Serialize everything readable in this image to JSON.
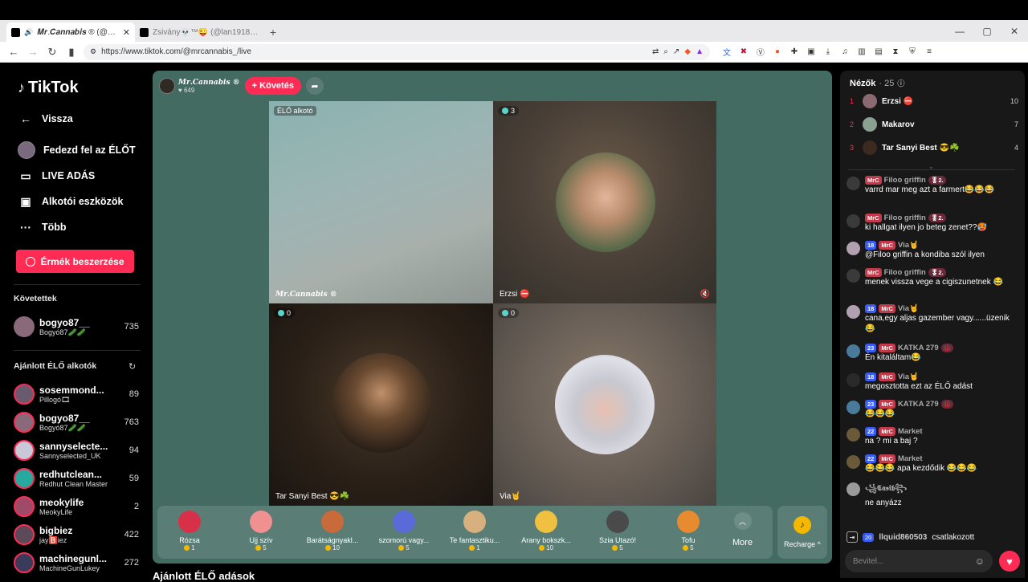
{
  "browser": {
    "tabs": [
      {
        "title": "𝑴𝒓.𝑪𝒂𝒏𝒏𝒂𝒃𝒊𝒔 ® (@mrcan",
        "close": "✕"
      },
      {
        "title": "Zsivány💀™😜 (@lan1918) ÉLŐ adás"
      }
    ],
    "new_tab": "+",
    "window": [
      "—",
      "▢",
      "✕"
    ],
    "url": "https://www.tiktok.com/@mrcannabis_/live"
  },
  "sidebar": {
    "logo": "TikTok",
    "nav": [
      {
        "label": "Vissza",
        "icon": "←"
      },
      {
        "label": "Fedezd fel az ÉLŐT",
        "icon": ""
      },
      {
        "label": "LIVE ADÁS",
        "icon": "▭"
      },
      {
        "label": "Alkotói eszközök",
        "icon": "▣"
      },
      {
        "label": "Több",
        "icon": "···"
      }
    ],
    "coins_button": "Érmék beszerzése",
    "following_title": "Követettek",
    "following": [
      {
        "name": "bogyo87__",
        "sub": "Bogyó87🥒🥒",
        "count": "735",
        "color": "#8a6a7a"
      }
    ],
    "recommended_title": "Ajánlott ÉLŐ alkotók",
    "recommended": [
      {
        "name": "sosemmond...",
        "sub": "Pillogó🎞",
        "count": "89",
        "color": "#6a5a70"
      },
      {
        "name": "bogyo87__",
        "sub": "Bogyó87🥒🥒",
        "count": "763",
        "color": "#8a6a7a"
      },
      {
        "name": "sannyselecte...",
        "sub": "Sannyselected_UK",
        "count": "94",
        "color": "#c8c8d8"
      },
      {
        "name": "redhutclean...",
        "sub": "Redhut Clean Master",
        "count": "59",
        "color": "#27a9a0"
      },
      {
        "name": "meokylife",
        "sub": "MeokyLife",
        "count": "2",
        "color": "#a04a6a"
      },
      {
        "name": "bigbiez",
        "sub": "jay🅱️iez",
        "count": "422",
        "color": "#5a4a5a"
      },
      {
        "name": "machinegunl...",
        "sub": "MachineGunLukey",
        "count": "272",
        "color": "#3a3a5a"
      }
    ]
  },
  "stage": {
    "host": {
      "name": "𝑴𝒓.𝑪𝒂𝒏𝒏𝒂𝒃𝒊𝒔 ®",
      "likes": "649"
    },
    "follow_label": "+ Követés",
    "cells": [
      {
        "tag": "ÉLŐ alkotó",
        "label": "𝑴𝒓.𝑪𝒂𝒏𝒏𝒂𝒃𝒊𝒔 ®"
      },
      {
        "badge": "3",
        "label": "Erzsi ⛔"
      },
      {
        "badge": "0",
        "label": "Tar Sanyi Best 😎☘️"
      },
      {
        "badge": "0",
        "label": "Via🤘"
      }
    ],
    "gifts": [
      {
        "name": "Rózsa",
        "price": "1",
        "color": "#d9304a"
      },
      {
        "name": "Ujj szív",
        "price": "5",
        "color": "#f09090"
      },
      {
        "name": "Barátságnyakl...",
        "price": "10",
        "color": "#c86a3a"
      },
      {
        "name": "szomorú vagy...",
        "price": "5",
        "color": "#5a6ad8"
      },
      {
        "name": "Te fantasztiku...",
        "price": "1",
        "color": "#d8b080"
      },
      {
        "name": "Arany bokszk...",
        "price": "10",
        "color": "#f0c040"
      },
      {
        "name": "Szia Utazó!",
        "price": "5",
        "color": "#4a4a4a"
      },
      {
        "name": "Tofu",
        "price": "5",
        "color": "#e88a30"
      }
    ],
    "more_label": "More",
    "recharge_label": "Recharge ^"
  },
  "below_title": "Ajánlott ÉLŐ adások",
  "chat": {
    "viewers_title": "Nézők",
    "viewers_count": "· 25",
    "top_viewers": [
      {
        "rank": "1",
        "name": "Erzsi ⛔",
        "count": "10",
        "color": "#8a6a70"
      },
      {
        "rank": "2",
        "name": "Makarov",
        "count": "7",
        "color": "#8aa090"
      },
      {
        "rank": "3",
        "name": "Tar Sanyi Best 😎☘️",
        "count": "4",
        "color": "#3a2a20"
      }
    ],
    "messages": [
      {
        "badges": [
          "MrC"
        ],
        "user": "Filoo griffin",
        "extra": "🎖2.",
        "text": "varrd mar meg azt a farmert😂😂😂",
        "color": "#3a3a3a"
      },
      {
        "badges": [
          "MrC"
        ],
        "user": "Filoo griffin",
        "extra": "🎖2.",
        "text": "ki hallgat ilyen jo beteg zenet??🥵",
        "color": "#3a3a3a"
      },
      {
        "badges": [
          "18",
          "MrC"
        ],
        "user": "Via🤘",
        "extra": "",
        "text": "@Filoo griffin a kondiba szól ilyen",
        "color": "#b0a0b0"
      },
      {
        "badges": [
          "MrC"
        ],
        "user": "Filoo griffin",
        "extra": "🎖2.",
        "text": "menek vissza vege a cigiszunetnek 😂",
        "color": "#3a3a3a"
      },
      {
        "badges": [
          "18",
          "MrC"
        ],
        "user": "Via🤘",
        "extra": "",
        "text": "cana,egy aljas gazember vagy......üzenik😂",
        "color": "#b0a0b0"
      },
      {
        "badges": [
          "23",
          "MrC"
        ],
        "user": "KATKA 279",
        "extra": "🐞",
        "text": "Én kitaláltam😂",
        "color": "#4a7a9a"
      },
      {
        "badges": [
          "18",
          "MrC"
        ],
        "user": "Via🤘",
        "extra": "",
        "text": "megosztotta ezt az ÉLŐ adást",
        "color": "#2a2a2a"
      },
      {
        "badges": [
          "23",
          "MrC"
        ],
        "user": "KATKA 279",
        "extra": "🐞",
        "text": "😂😂😂",
        "color": "#4a7a9a"
      },
      {
        "badges": [
          "22",
          "MrC"
        ],
        "user": "Market",
        "extra": "",
        "text": "na ? mi a baj ?",
        "color": "#6a5a3a"
      },
      {
        "badges": [
          "22",
          "MrC"
        ],
        "user": "Market",
        "extra": "",
        "text": "😂😂😂 apa kezdődik 😂😂😂",
        "color": "#6a5a3a"
      },
      {
        "badges": [],
        "user": "꧁𝕮𝖆𝖘𝖎𝖇꧂",
        "extra": "",
        "text": "ne anyázz",
        "color": "#9a9a9a"
      }
    ],
    "join": {
      "badge": "20",
      "user": "llquid860503",
      "text": "csatlakozott"
    },
    "input_placeholder": "Bevitel..."
  }
}
